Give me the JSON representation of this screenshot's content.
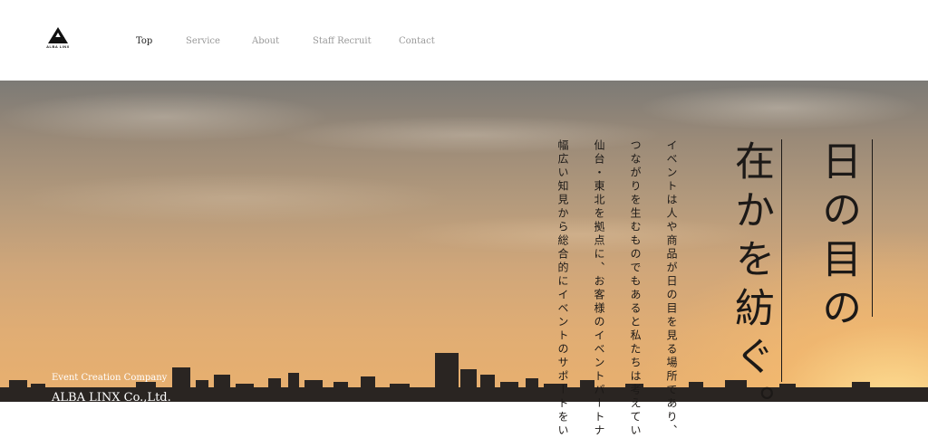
{
  "header": {
    "logo_text": "ALBA LINX",
    "nav": [
      {
        "label": "Top",
        "active": true
      },
      {
        "label": "Service",
        "active": false
      },
      {
        "label": "About",
        "active": false
      },
      {
        "label": "Staff Recruit",
        "active": false
      },
      {
        "label": "Contact",
        "active": false
      }
    ]
  },
  "hero": {
    "headline": [
      "日の目の",
      "在かを紡ぐ。"
    ],
    "body": [
      "イベントは人や商品が日の目を見る場所であり、",
      "つながりを生むものでもあると私たちは考えてい",
      "仙台・東北を拠点に、お客様のイベントパートナ",
      "幅広い知見から総合的にイベントのサポートをい"
    ],
    "tagline": "Event Creation Company",
    "company": "ALBA LINX Co.,Ltd."
  },
  "colors": {
    "text_dark": "#1c1917",
    "nav_inactive": "#999999",
    "nav_active": "#222222",
    "sky_warm": "#e9b06e"
  }
}
